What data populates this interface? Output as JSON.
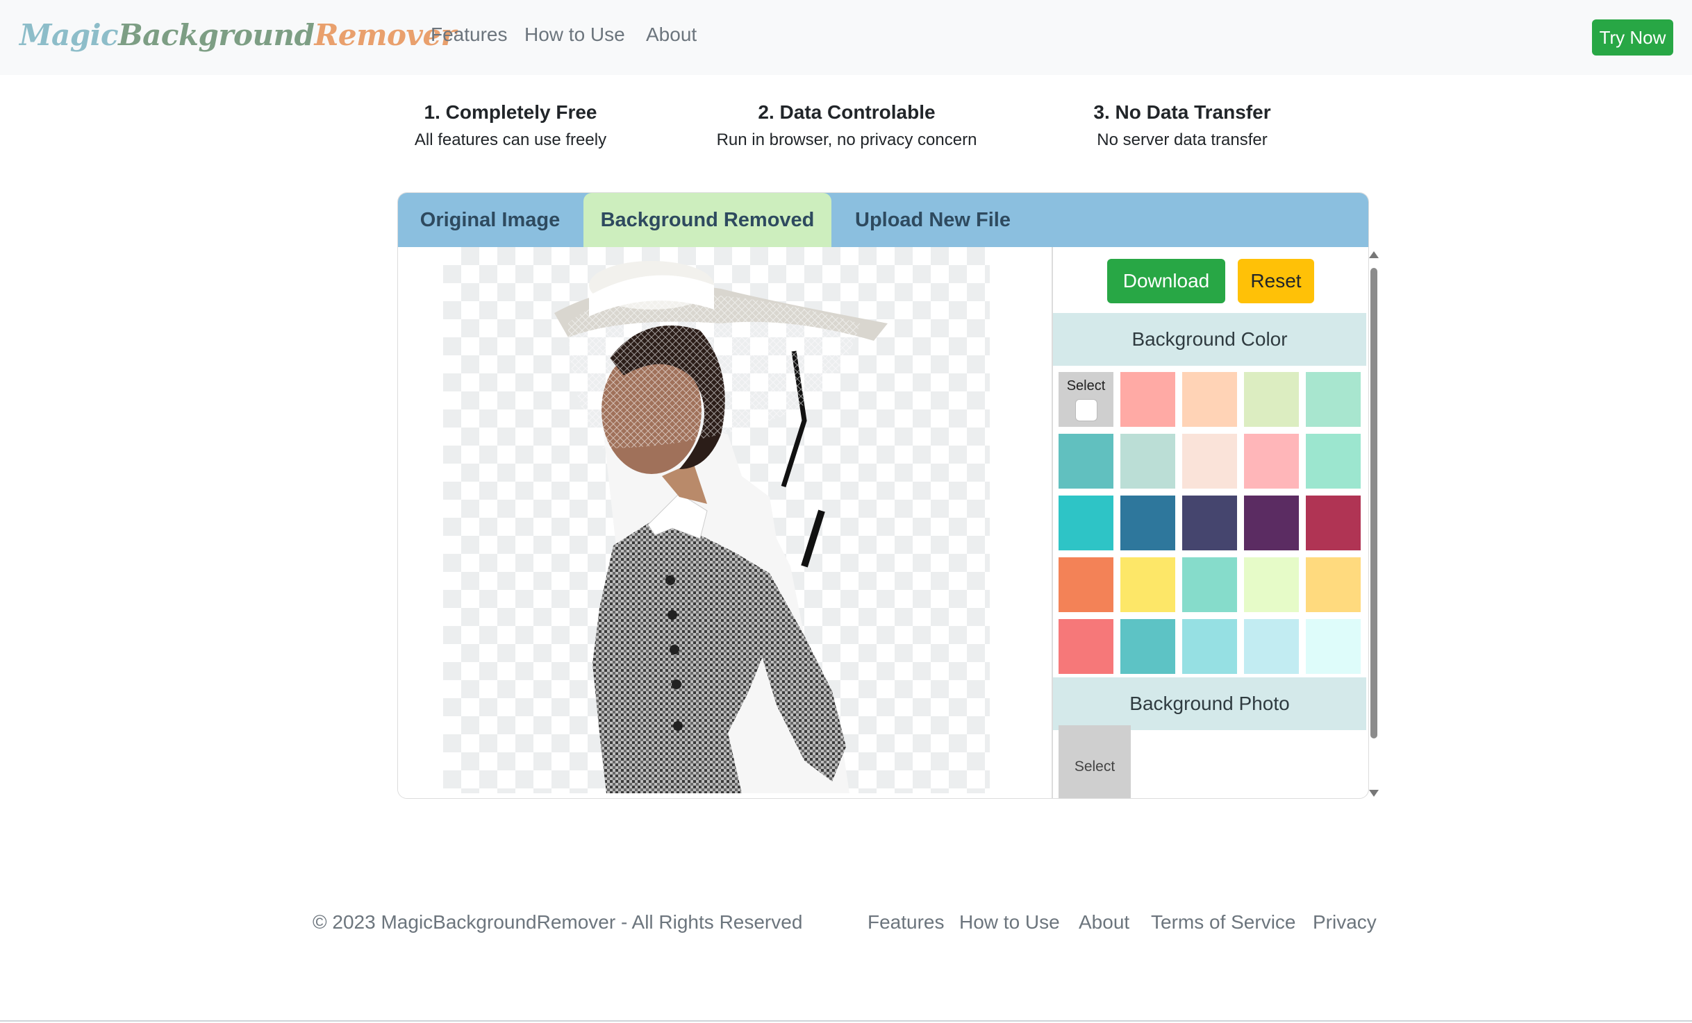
{
  "navbar": {
    "brand": {
      "part1": "Magic",
      "part2": "Background",
      "part3": "Remover"
    },
    "links": [
      "Features",
      "How to Use",
      "About"
    ],
    "cta": "Try Now"
  },
  "features": [
    {
      "title": "1. Completely Free",
      "desc": "All features can use freely"
    },
    {
      "title": "2. Data Controlable",
      "desc": "Run in browser, no privacy concern"
    },
    {
      "title": "3. No Data Transfer",
      "desc": "No server data transfer"
    }
  ],
  "tabs": [
    {
      "label": "Original Image",
      "active": false
    },
    {
      "label": "Background Removed",
      "active": true
    },
    {
      "label": "Upload New File",
      "active": false
    }
  ],
  "panel": {
    "download_label": "Download",
    "reset_label": "Reset",
    "bg_color_heading": "Background Color",
    "select_label": "Select",
    "bg_photo_heading": "Background Photo",
    "photo_select_label": "Select",
    "colors": [
      "#ffaaa5",
      "#ffd3b6",
      "#dcedc1",
      "#a8e6cf",
      "#61c0bf",
      "#bbded6",
      "#fae3d9",
      "#ffb6b9",
      "#9ce6cf",
      "#2ec4c6",
      "#2e779c",
      "#45456e",
      "#5b2c62",
      "#b03454",
      "#f38257",
      "#fde768",
      "#86dccb",
      "#e6fbc8",
      "#ffda7e",
      "#f67879",
      "#5dc3c5",
      "#96e0e3",
      "#c2ecf2",
      "#defcfa"
    ]
  },
  "footer": {
    "copyright": "© 2023 MagicBackgroundRemover - All Rights Reserved",
    "links": [
      "Features",
      "How to Use",
      "About",
      "Terms of Service",
      "Privacy"
    ]
  }
}
